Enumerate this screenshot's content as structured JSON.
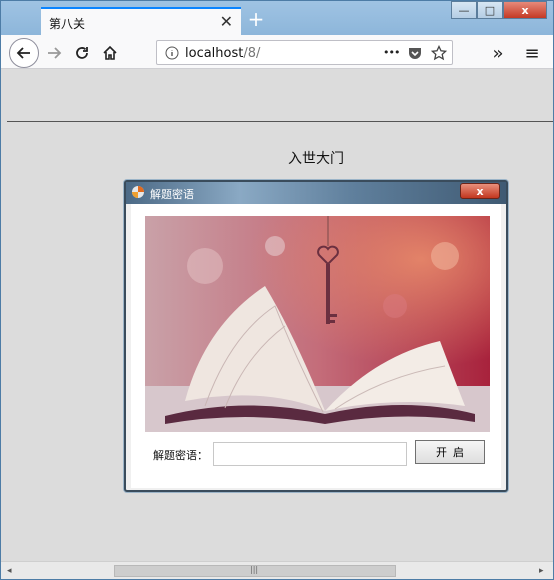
{
  "browser": {
    "tab_title": "第八关",
    "url_host": "localhost",
    "url_path": "/8/",
    "new_tab_symbol": "+",
    "overflow_symbol": "»",
    "menu_symbol": "≡",
    "more_symbol": "•••"
  },
  "window_controls": {
    "minimize": "—",
    "maximize": "□",
    "close": "x"
  },
  "page": {
    "heading": "入世大门"
  },
  "dialog": {
    "title": "解题密语",
    "close_symbol": "x",
    "password_label": "解题密语：",
    "password_value": "",
    "open_button": "开启"
  },
  "scrollbar": {
    "left_arrow": "◂",
    "right_arrow": "▸",
    "grip": "|||"
  }
}
